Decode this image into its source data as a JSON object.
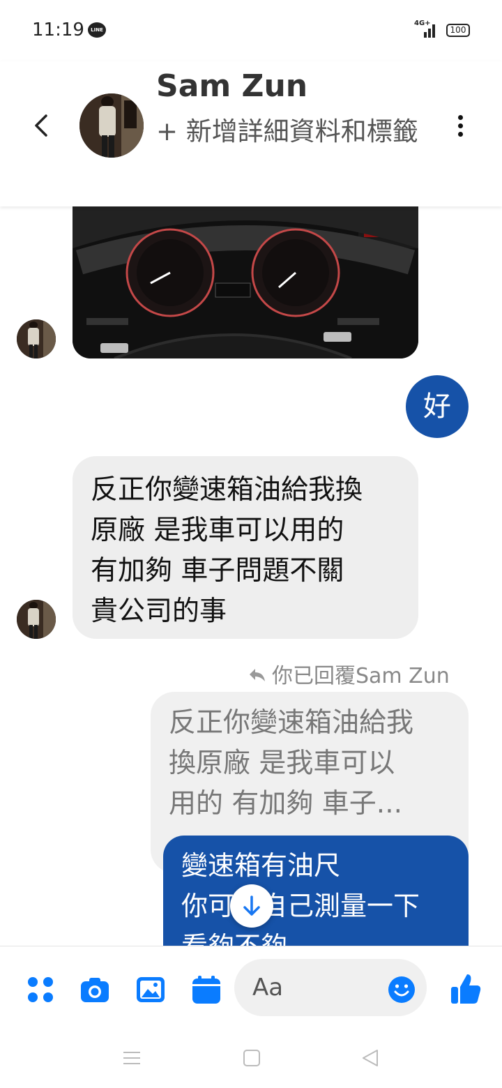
{
  "status_bar": {
    "time": "11:19",
    "notification_icon": "line-app-icon",
    "line_label": "LINE",
    "network_label": "4G+",
    "battery_level": "100"
  },
  "header": {
    "contact_name": "Sam Zun",
    "add_details_label": "+ 新增詳細資料和標籤",
    "back_icon": "chevron-left-icon",
    "more_icon": "vertical-dots-icon"
  },
  "messages": {
    "ok_message": "好",
    "long_message_lines": [
      "反正你變速箱油給我換",
      "原廠  是我車可以用的",
      "有加夠   車子問題不關",
      "貴公司的事"
    ],
    "reply_label": "你已回覆Sam Zun",
    "quoted_lines": [
      "反正你變速箱油給我",
      "換原廠  是我車可以",
      "用的   有加夠   車子..."
    ],
    "reply_lines": [
      "變速箱有油尺",
      "你可以自己測量一下",
      "看夠不夠"
    ]
  },
  "composer": {
    "placeholder": "Aa",
    "icons": [
      "menu-grid-icon",
      "camera-icon",
      "gallery-icon",
      "calendar-icon",
      "emoji-icon",
      "thumbs-up-icon"
    ]
  },
  "colors": {
    "accent": "#0a7cff",
    "my_bubble": "#1652a8",
    "their_bubble": "#eeeeee"
  }
}
